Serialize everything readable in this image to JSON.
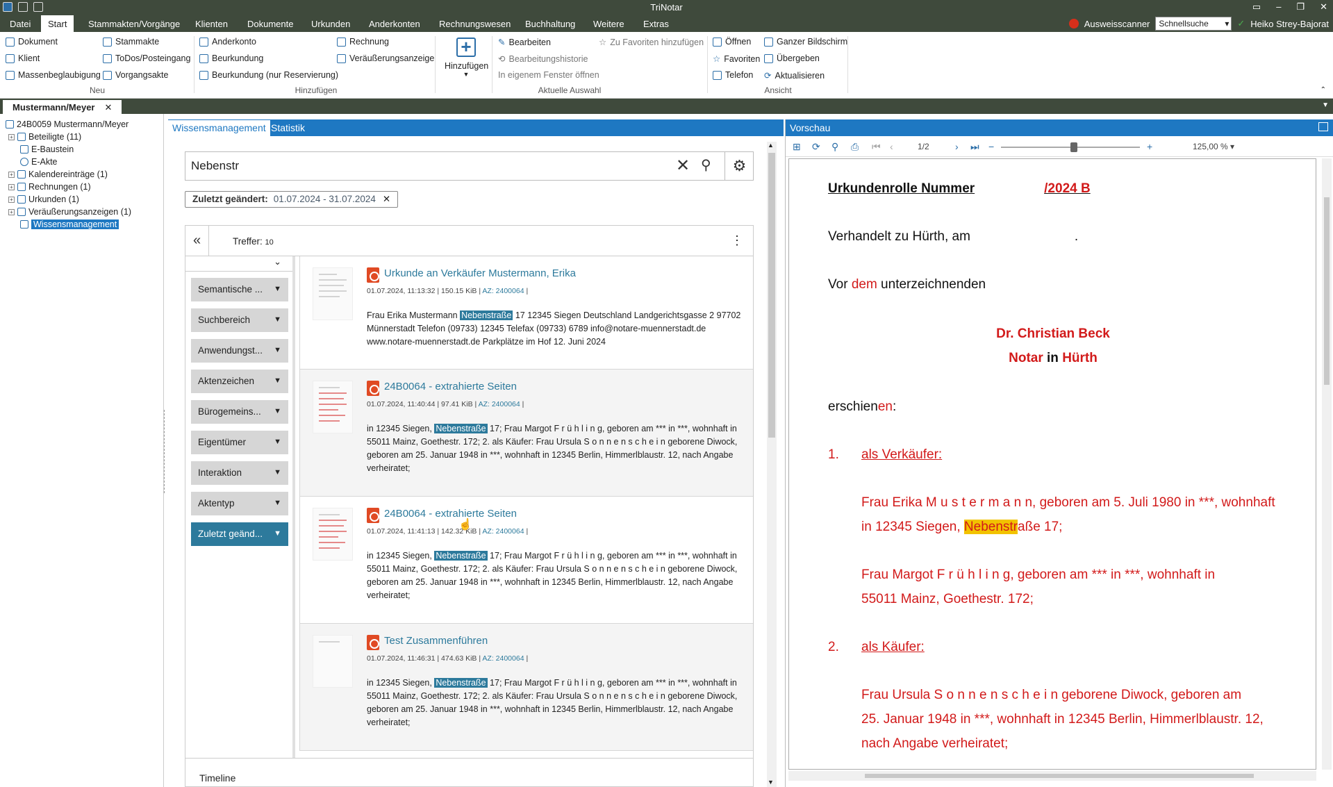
{
  "app": {
    "title": "TriNotar"
  },
  "menu": {
    "items": [
      "Datei",
      "Start",
      "Stammakten/Vorgänge",
      "Klienten",
      "Dokumente",
      "Urkunden",
      "Anderkonten",
      "Rechnungswesen",
      "Buchhaltung",
      "Weitere",
      "Extras"
    ],
    "active": "Start",
    "scanner_label": "Ausweisscanner",
    "quicksearch": "Schnellsuche",
    "user": "Heiko Strey-Bajorat"
  },
  "ribbon": {
    "neu": {
      "items": [
        "Dokument",
        "Klient",
        "Massenbeglaubigung",
        "Stammakte",
        "ToDos/Posteingang",
        "Vorgangsakte"
      ],
      "label": "Neu"
    },
    "hinzufuegen": {
      "items": [
        "Anderkonto",
        "Beurkundung",
        "Beurkundung (nur Reservierung)",
        "Rechnung",
        "Veräußerungsanzeige"
      ],
      "label": "Hinzufügen",
      "big_button": "Hinzufügen"
    },
    "auswahl": {
      "items": [
        "Bearbeiten",
        "Bearbeitungshistorie",
        "In eigenem Fenster öffnen",
        "Zu Favoriten hinzufügen"
      ],
      "label": "Aktuelle Auswahl"
    },
    "ansicht": {
      "items": [
        "Öffnen",
        "Favoriten",
        "Telefon",
        "Ganzer Bildschirm",
        "Übergeben",
        "Aktualisieren"
      ],
      "label": "Ansicht"
    }
  },
  "doctab": {
    "label": "Mustermann/Meyer"
  },
  "tree": {
    "items": [
      {
        "label": "24B0059 Mustermann/Meyer"
      },
      {
        "label": "Beteiligte (11)"
      },
      {
        "label": "E-Baustein"
      },
      {
        "label": "E-Akte"
      },
      {
        "label": "Kalendereinträge (1)"
      },
      {
        "label": "Rechnungen (1)"
      },
      {
        "label": "Urkunden (1)"
      },
      {
        "label": "Veräußerungsanzeigen (1)"
      },
      {
        "label": "Wissensmanagement"
      }
    ]
  },
  "wm": {
    "tabs": [
      "Wissensmanagement",
      "Statistik"
    ],
    "search_value": "Nebenstr",
    "filter_label": "Zuletzt geändert:",
    "filter_value": "01.07.2024 - 31.07.2024",
    "hits_label": "Treffer:",
    "hits": "10",
    "facets": [
      "Semantische ...",
      "Suchbereich",
      "Anwendungst...",
      "Aktenzeichen",
      "Bürogemeins...",
      "Eigentümer",
      "Interaktion",
      "Aktentyp",
      "Zuletzt geänd..."
    ],
    "timeline": "Timeline",
    "results": [
      {
        "title": "Urkunde an Verkäufer Mustermann, Erika",
        "date": "01.07.2024, 11:13:32",
        "size": "150.15 KiB",
        "az": "AZ: 2400064",
        "pre": "Frau Erika Mustermann ",
        "hl": "Nebenstraße",
        "post": " 17 12345 Siegen Deutschland Landgerichtsgasse 2 97702 Münnerstadt Telefon (09733) 12345 Telefax (09733) 6789 info@notare-muennerstadt.de www.notare-muennerstadt.de Parkplätze im Hof 12. Juni 2024"
      },
      {
        "title": "24B0064 - extrahierte Seiten",
        "date": "01.07.2024, 11:40:44",
        "size": "97.41 KiB",
        "az": "AZ: 2400064",
        "pre": "in 12345 Siegen, ",
        "hl": "Nebenstraße",
        "post": " 17; Frau Margot F r ü h l i n g, geboren am *** in ***, wohnhaft in 55011 Mainz, Goethestr. 172; 2. als Käufer: Frau Ursula S o n n e n s c h e i n geborene Diwock, geboren am 25. Januar 1948 in ***, wohnhaft in 12345 Berlin, Himmerlblaustr. 12, nach Angabe verheiratet;"
      },
      {
        "title": "24B0064 - extrahierte Seiten",
        "date": "01.07.2024, 11:41:13",
        "size": "142.32 KiB",
        "az": "AZ: 2400064",
        "pre": "in 12345 Siegen, ",
        "hl": "Nebenstraße",
        "post": " 17; Frau Margot F r ü h l i n g, geboren am *** in ***, wohnhaft in 55011 Mainz, Goethestr. 172; 2. als Käufer: Frau Ursula S o n n e n s c h e i n geborene Diwock, geboren am 25. Januar 1948 in ***, wohnhaft in 12345 Berlin, Himmerlblaustr. 12, nach Angabe verheiratet;"
      },
      {
        "title": "Test Zusammenführen",
        "date": "01.07.2024, 11:46:31",
        "size": "474.63 KiB",
        "az": "AZ: 2400064",
        "pre": "in 12345 Siegen, ",
        "hl": "Nebenstraße",
        "post": " 17; Frau Margot F r ü h l i n g, geboren am *** in ***, wohnhaft in 55011 Mainz, Goethestr. 172; 2. als Käufer: Frau Ursula S o n n e n s c h e i n geborene Diwock, geboren am 25. Januar 1948 in ***, wohnhaft in 12345 Berlin, Himmerlblaustr. 12, nach Angabe verheiratet;"
      }
    ]
  },
  "preview": {
    "title": "Vorschau",
    "page": "1/2",
    "zoom": "125,00 %",
    "doc": {
      "heading_a": "Urkundenrolle Nummer",
      "heading_b": "/2024 B",
      "line1": "Verhandelt zu Hürth, am",
      "line1_dot": ".",
      "line2_a": "Vor ",
      "line2_b": "dem",
      "line2_c": " unterzeichnenden",
      "notary_name": "Dr. Christian Beck",
      "notary_a": "Notar",
      "notary_b": " in ",
      "notary_c": "Hürth",
      "erschien_a": "erschien",
      "erschien_b": "en",
      "erschien_c": ":",
      "n1": "1.",
      "seller_label": "als Verkäufer:",
      "seller1_l1": "Frau Erika M u s t e r m a n n, geboren am 5. Juli 1980 in ***, wohnhaft",
      "seller1_l2a": "in 12345 Siegen, ",
      "seller1_hl": "Nebenstr",
      "seller1_l2b": "aße 17;",
      "seller2_l1": "Frau Margot F r ü h l i n g, geboren am *** in ***, wohnhaft in",
      "seller2_l2": "55011 Mainz, Goethestr. 172;",
      "n2": "2.",
      "buyer_label": "als Käufer:",
      "buyer_l1": "Frau Ursula S o n n e n s c h e i n geborene Diwock, geboren am",
      "buyer_l2": "25. Januar 1948 in ***, wohnhaft in 12345 Berlin, Himmerlblaustr. 12,",
      "buyer_l3": "nach Angabe verheiratet;"
    }
  },
  "colors": {
    "accent": "#1e78c2",
    "chrome": "#3f4a3c",
    "facet_active": "#2d7a9c",
    "doc_red": "#d21a1a",
    "highlight": "#f2c200"
  }
}
